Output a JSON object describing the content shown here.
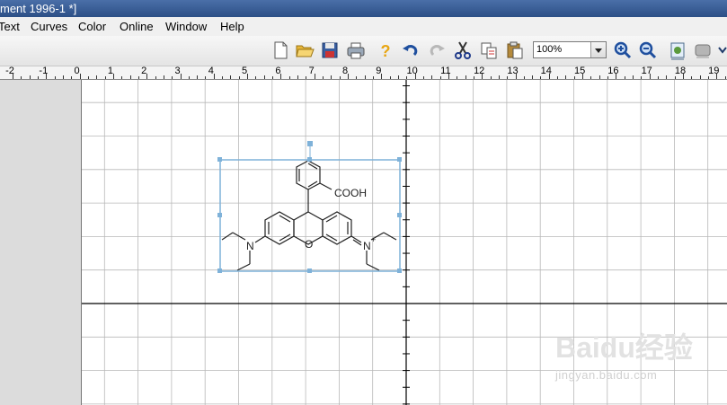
{
  "window": {
    "title": "ment 1996-1 *]"
  },
  "menu": [
    {
      "label": "Text"
    },
    {
      "label": "Curves"
    },
    {
      "label": "Color"
    },
    {
      "label": "Online"
    },
    {
      "label": "Window"
    },
    {
      "label": "Help"
    }
  ],
  "toolbar": {
    "buttons": [
      {
        "name": "new-document-icon"
      },
      {
        "name": "open-folder-icon"
      },
      {
        "name": "save-icon"
      },
      {
        "name": "print-icon"
      },
      {
        "name": "help-icon"
      },
      {
        "name": "undo-icon"
      },
      {
        "name": "redo-icon"
      },
      {
        "name": "cut-icon"
      },
      {
        "name": "copy-icon"
      },
      {
        "name": "paste-icon"
      }
    ],
    "zoom_value": "100%",
    "zoom_buttons": [
      {
        "name": "zoom-in-icon"
      },
      {
        "name": "zoom-out-icon"
      },
      {
        "name": "fit-page-icon"
      },
      {
        "name": "zoom-region-icon"
      },
      {
        "name": "more-chevron-icon"
      }
    ]
  },
  "ruler": {
    "labels": [
      "-2",
      "-1",
      "0",
      "1",
      "2",
      "3",
      "4",
      "5",
      "6",
      "7",
      "8",
      "9",
      "10",
      "11",
      "12",
      "13",
      "14",
      "15",
      "16",
      "17",
      "18",
      "19"
    ]
  },
  "structure": {
    "name": "Rhodamine B",
    "labels": {
      "cooh": "COOH",
      "n_left": "N",
      "n_right": "N",
      "n_right_charge": "+",
      "o_ring": "O"
    }
  },
  "watermark": {
    "logo": "Baidu经验",
    "url": "jingyan.baidu.com"
  },
  "colors": {
    "selection": "#7fb2d9",
    "title_bar": "#3a5d96",
    "grid_major": "#b8b8b8",
    "axis": "#000000"
  }
}
